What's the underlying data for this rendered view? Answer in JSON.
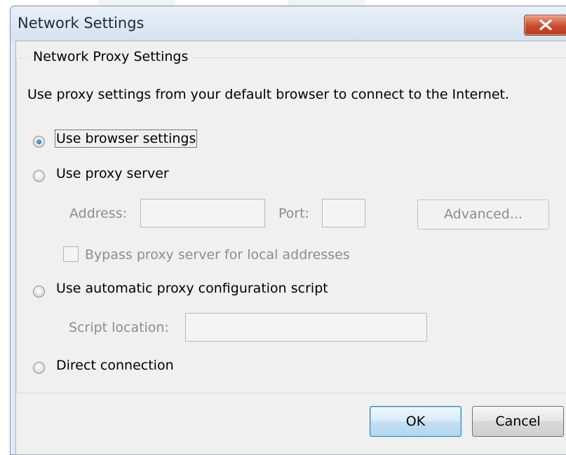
{
  "window": {
    "title": "Network Settings"
  },
  "group": {
    "legend": "Network Proxy Settings",
    "description": "Use proxy settings from your default browser to connect to the Internet."
  },
  "options": {
    "browser_settings": {
      "label": "Use browser settings",
      "selected": true
    },
    "proxy_server": {
      "label": "Use proxy server",
      "selected": false
    },
    "auto_script": {
      "label": "Use automatic proxy configuration script",
      "selected": false
    },
    "direct": {
      "label": "Direct connection",
      "selected": false
    }
  },
  "proxy": {
    "address_label": "Address:",
    "address_value": "",
    "port_label": "Port:",
    "port_value": "",
    "advanced_label": "Advanced...",
    "bypass_label": "Bypass proxy server for local addresses"
  },
  "script": {
    "location_label": "Script location:",
    "location_value": ""
  },
  "buttons": {
    "ok": "OK",
    "cancel": "Cancel"
  },
  "icons": {
    "close": "close-x-icon"
  },
  "colors": {
    "close_button": "#c94b2c",
    "disabled_text": "#8d8d8d",
    "selected_radio_dot": "#1c5a9c"
  }
}
